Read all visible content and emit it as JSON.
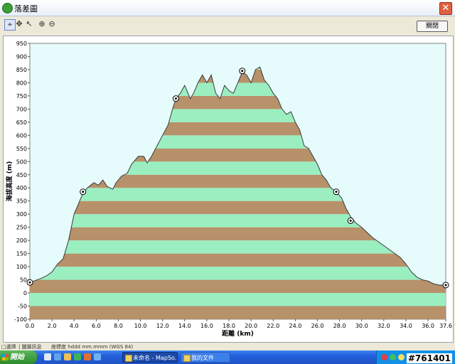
{
  "window": {
    "title": "落差圖",
    "close_symbol": "✕"
  },
  "toolbar": {
    "tools": [
      {
        "name": "crosshair-tool-icon",
        "glyph": "⌖"
      },
      {
        "name": "move-tool-icon",
        "glyph": "✥"
      },
      {
        "name": "select-tool-icon",
        "glyph": "↖"
      },
      {
        "name": "zoom-in-icon",
        "glyph": "⊕"
      },
      {
        "name": "zoom-out-icon",
        "glyph": "⊖"
      }
    ],
    "close_label": "關閉"
  },
  "chart_data": {
    "type": "area",
    "xlabel": "距離  (km)",
    "ylabel": "海拔高度 (m)",
    "xlim": [
      0.0,
      37.6
    ],
    "ylim": [
      -100,
      950
    ],
    "xticks": [
      "0.0",
      "2.0",
      "4.0",
      "6.0",
      "8.0",
      "10.0",
      "12.0",
      "14.0",
      "16.0",
      "18.0",
      "20.0",
      "22.0",
      "24.0",
      "26.0",
      "28.0",
      "30.0",
      "32.0",
      "34.0",
      "36.0",
      "37.6"
    ],
    "xtick_values": [
      0,
      2,
      4,
      6,
      8,
      10,
      12,
      14,
      16,
      18,
      20,
      22,
      24,
      26,
      28,
      30,
      32,
      34,
      36,
      37.6
    ],
    "yticks": [
      -100,
      -50,
      0,
      50,
      100,
      150,
      200,
      250,
      300,
      350,
      400,
      450,
      500,
      550,
      600,
      650,
      700,
      750,
      800,
      850,
      900,
      950
    ],
    "band_step_m": 50,
    "colors": {
      "plot_bg": "#e6fbfb",
      "band_light": "#9aeec0",
      "band_dark": "#b7916a",
      "outline": "#3a3a3a"
    },
    "profile": [
      [
        0.0,
        40
      ],
      [
        1.0,
        55
      ],
      [
        1.5,
        65
      ],
      [
        2.0,
        80
      ],
      [
        2.5,
        110
      ],
      [
        3.0,
        130
      ],
      [
        3.5,
        200
      ],
      [
        4.0,
        300
      ],
      [
        4.4,
        340
      ],
      [
        4.8,
        380
      ],
      [
        5.2,
        400
      ],
      [
        5.8,
        420
      ],
      [
        6.2,
        410
      ],
      [
        6.6,
        430
      ],
      [
        7.0,
        405
      ],
      [
        7.5,
        395
      ],
      [
        7.8,
        420
      ],
      [
        8.3,
        445
      ],
      [
        8.8,
        455
      ],
      [
        9.2,
        490
      ],
      [
        9.8,
        520
      ],
      [
        10.3,
        520
      ],
      [
        10.6,
        495
      ],
      [
        11.0,
        520
      ],
      [
        11.5,
        560
      ],
      [
        12.0,
        600
      ],
      [
        12.5,
        640
      ],
      [
        12.9,
        700
      ],
      [
        13.2,
        740
      ],
      [
        13.6,
        760
      ],
      [
        14.0,
        790
      ],
      [
        14.5,
        740
      ],
      [
        14.8,
        760
      ],
      [
        15.2,
        800
      ],
      [
        15.6,
        830
      ],
      [
        16.0,
        800
      ],
      [
        16.4,
        830
      ],
      [
        16.8,
        760
      ],
      [
        17.2,
        740
      ],
      [
        17.6,
        790
      ],
      [
        18.0,
        770
      ],
      [
        18.4,
        760
      ],
      [
        18.8,
        800
      ],
      [
        19.2,
        840
      ],
      [
        19.6,
        830
      ],
      [
        20.0,
        800
      ],
      [
        20.4,
        850
      ],
      [
        20.8,
        860
      ],
      [
        21.2,
        810
      ],
      [
        21.6,
        790
      ],
      [
        22.0,
        760
      ],
      [
        22.4,
        740
      ],
      [
        22.8,
        700
      ],
      [
        23.2,
        680
      ],
      [
        23.6,
        690
      ],
      [
        24.0,
        650
      ],
      [
        24.4,
        620
      ],
      [
        24.8,
        560
      ],
      [
        25.2,
        550
      ],
      [
        25.6,
        520
      ],
      [
        26.0,
        490
      ],
      [
        26.4,
        450
      ],
      [
        26.8,
        430
      ],
      [
        27.2,
        400
      ],
      [
        27.7,
        385
      ],
      [
        28.2,
        360
      ],
      [
        28.6,
        320
      ],
      [
        29.0,
        290
      ],
      [
        29.5,
        265
      ],
      [
        30.0,
        250
      ],
      [
        30.5,
        230
      ],
      [
        31.0,
        210
      ],
      [
        31.5,
        195
      ],
      [
        32.0,
        180
      ],
      [
        32.5,
        165
      ],
      [
        33.0,
        150
      ],
      [
        33.5,
        135
      ],
      [
        34.0,
        110
      ],
      [
        34.5,
        80
      ],
      [
        35.0,
        60
      ],
      [
        35.5,
        50
      ],
      [
        36.0,
        45
      ],
      [
        36.5,
        35
      ],
      [
        37.0,
        30
      ],
      [
        37.6,
        30
      ]
    ],
    "markers": [
      {
        "x": 0.0,
        "y": 40
      },
      {
        "x": 4.8,
        "y": 385
      },
      {
        "x": 13.2,
        "y": 740
      },
      {
        "x": 19.2,
        "y": 845
      },
      {
        "x": 27.7,
        "y": 385
      },
      {
        "x": 29.0,
        "y": 275
      },
      {
        "x": 37.6,
        "y": 30
      }
    ]
  },
  "statusbar": {
    "items": [
      "□選擇",
      "| 圖層訊息",
      "座標度 hddd mm.mmm (WGS 84)"
    ]
  },
  "taskbar": {
    "start_label": "開始",
    "tasks": [
      "未命名 - MapSo...",
      "我的文件"
    ]
  },
  "watermark": "#761401"
}
